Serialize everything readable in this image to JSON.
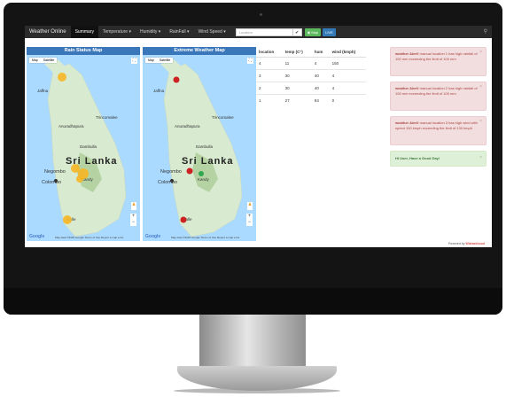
{
  "navbar": {
    "brand": "Weather Online",
    "items": [
      "Summary",
      "Temperature ▾",
      "Humidity ▾",
      "RainFall ▾",
      "Wind Speed ▾"
    ],
    "location_placeholder": "Location",
    "map_button": "Map",
    "live_button": "LIVE"
  },
  "rain_map": {
    "title": "Rain Status Map",
    "toggle": [
      "Map",
      "Satellite"
    ]
  },
  "weather_map": {
    "title": "Extreme Weather Map",
    "toggle": [
      "Map",
      "Satellite"
    ]
  },
  "map_labels": {
    "country": "Sri Lanka",
    "anuradhapura": "Anuradhapura",
    "trincomalee": "Trincomalee",
    "dambulla": "Dambulla",
    "negombo": "Negombo",
    "colombo": "Colombo",
    "kandy": "Kandy",
    "galle": "Galle",
    "jaffna": "Jaffna",
    "google": "Google",
    "attribution": "Map data ©2018 Google   Terms of Use   Report a map error"
  },
  "table": {
    "headers": [
      "location",
      "temp (C°)",
      "hum",
      "wind (kmph)"
    ],
    "rows": [
      [
        "4",
        "11",
        "4",
        "150"
      ],
      [
        "3",
        "30",
        "40",
        "4"
      ],
      [
        "2",
        "30",
        "40",
        "4"
      ],
      [
        "1",
        "27",
        "84",
        "0"
      ]
    ]
  },
  "alerts": [
    {
      "title": "weather Alert!",
      "text": "manual location 1 has high rainfall of 100 mm exceeding the limit of 100 mm"
    },
    {
      "title": "weather Alert!",
      "text": "manual location 2 has high rainfall of 100 mm exceeding the limit of 100 mm"
    },
    {
      "title": "weather Alert!",
      "text": "manual location 3 has high wind with speed 150 kmph exceeding the limit of 130 kmph"
    }
  ],
  "greeting": "Hi User, Have a Good Day!",
  "footer": {
    "powered_by": "Powered by",
    "brand": "Wiztaskhood"
  },
  "colors": {
    "panel_header": "#3a76ba",
    "navbar": "#2b2b2b",
    "alert_danger": "#f2dede",
    "alert_success": "#dff0d8"
  }
}
